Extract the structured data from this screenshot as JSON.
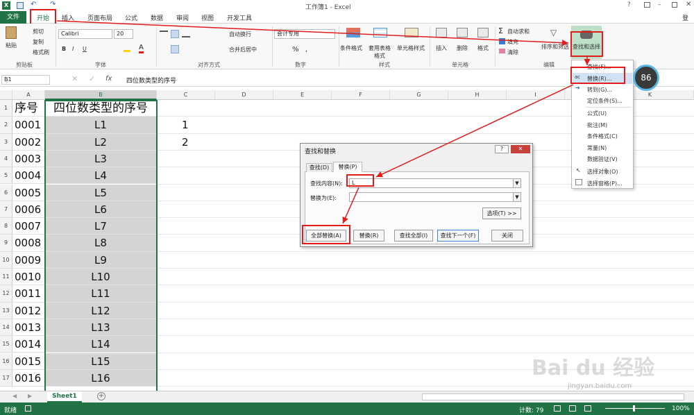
{
  "window": {
    "title": "工作簿1 - Excel",
    "signin": "登录"
  },
  "tabs": [
    "文件",
    "开始",
    "插入",
    "页面布局",
    "公式",
    "数据",
    "审阅",
    "视图",
    "开发工具"
  ],
  "clipboard": {
    "paste": "粘贴",
    "cut": "剪切",
    "copy": "复制",
    "format_painter": "格式刷",
    "group": "剪贴板"
  },
  "font": {
    "name": "Calibri",
    "size": "20",
    "group": "字体",
    "bold": "B",
    "italic": "I",
    "underline": "U"
  },
  "alignment": {
    "wrap": "自动换行",
    "merge": "合并后居中",
    "group": "对齐方式"
  },
  "number": {
    "format": "会计专用",
    "percent": "%",
    "comma": ",",
    "group": "数字"
  },
  "styles": {
    "conditional": "条件格式",
    "table": "套用表格格式",
    "cell": "单元格样式",
    "group": "样式"
  },
  "cells": {
    "insert": "插入",
    "delete": "删除",
    "format": "格式",
    "group": "单元格"
  },
  "editing": {
    "autosum": "自动求和",
    "fill": "填充",
    "clear": "清除",
    "sort": "排序和筛选",
    "find": "查找和选择",
    "group": "编辑"
  },
  "formula_bar": {
    "namebox": "B1",
    "fx": "fx",
    "content": "四位数类型的序号"
  },
  "columns": [
    "A",
    "B",
    "C",
    "D",
    "E",
    "F",
    "G",
    "H",
    "I",
    "K"
  ],
  "rows": [
    {
      "n": "1",
      "a": "序号",
      "b": "四位数类型的序号",
      "c": ""
    },
    {
      "n": "2",
      "a": "0001",
      "b": "L1",
      "c": "1"
    },
    {
      "n": "3",
      "a": "0002",
      "b": "L2",
      "c": "2"
    },
    {
      "n": "4",
      "a": "0003",
      "b": "L3",
      "c": ""
    },
    {
      "n": "5",
      "a": "0004",
      "b": "L4",
      "c": ""
    },
    {
      "n": "6",
      "a": "0005",
      "b": "L5",
      "c": ""
    },
    {
      "n": "7",
      "a": "0006",
      "b": "L6",
      "c": ""
    },
    {
      "n": "8",
      "a": "0007",
      "b": "L7",
      "c": ""
    },
    {
      "n": "9",
      "a": "0008",
      "b": "L8",
      "c": ""
    },
    {
      "n": "10",
      "a": "0009",
      "b": "L9",
      "c": ""
    },
    {
      "n": "11",
      "a": "0010",
      "b": "L10",
      "c": ""
    },
    {
      "n": "12",
      "a": "0011",
      "b": "L11",
      "c": ""
    },
    {
      "n": "13",
      "a": "0012",
      "b": "L12",
      "c": ""
    },
    {
      "n": "14",
      "a": "0013",
      "b": "L13",
      "c": ""
    },
    {
      "n": "15",
      "a": "0014",
      "b": "L14",
      "c": ""
    },
    {
      "n": "16",
      "a": "0015",
      "b": "L15",
      "c": ""
    },
    {
      "n": "17",
      "a": "0016",
      "b": "L16",
      "c": ""
    }
  ],
  "dialog": {
    "title": "查找和替换",
    "help": "?",
    "tab_find": "查找(D)",
    "tab_replace": "替换(P)",
    "find_label": "查找内容(N):",
    "find_value": "L",
    "replace_label": "替换为(E):",
    "replace_value": "",
    "options": "选项(T) >>",
    "replace_all": "全部替换(A)",
    "replace": "替换(R)",
    "find_all": "查找全部(I)",
    "find_next": "查找下一个(F)",
    "close": "关闭"
  },
  "menu": [
    "查找(F)...",
    "替换(R)...",
    "转到(G)...",
    "定位条件(S)...",
    "公式(U)",
    "批注(M)",
    "条件格式(C)",
    "常量(N)",
    "数据验证(V)",
    "选择对象(O)",
    "选择窗格(P)..."
  ],
  "badge": "86",
  "sheet": {
    "name": "Sheet1"
  },
  "status": {
    "ready": "就绪",
    "count": "计数: 79",
    "zoom": "100%"
  },
  "watermark": {
    "text": "Bai du 经验",
    "url": "jingyan.baidu.com"
  },
  "colors": {
    "excel_green": "#217346",
    "annotation_red": "#e21b1b",
    "selection_gray": "#d4d4d4"
  }
}
